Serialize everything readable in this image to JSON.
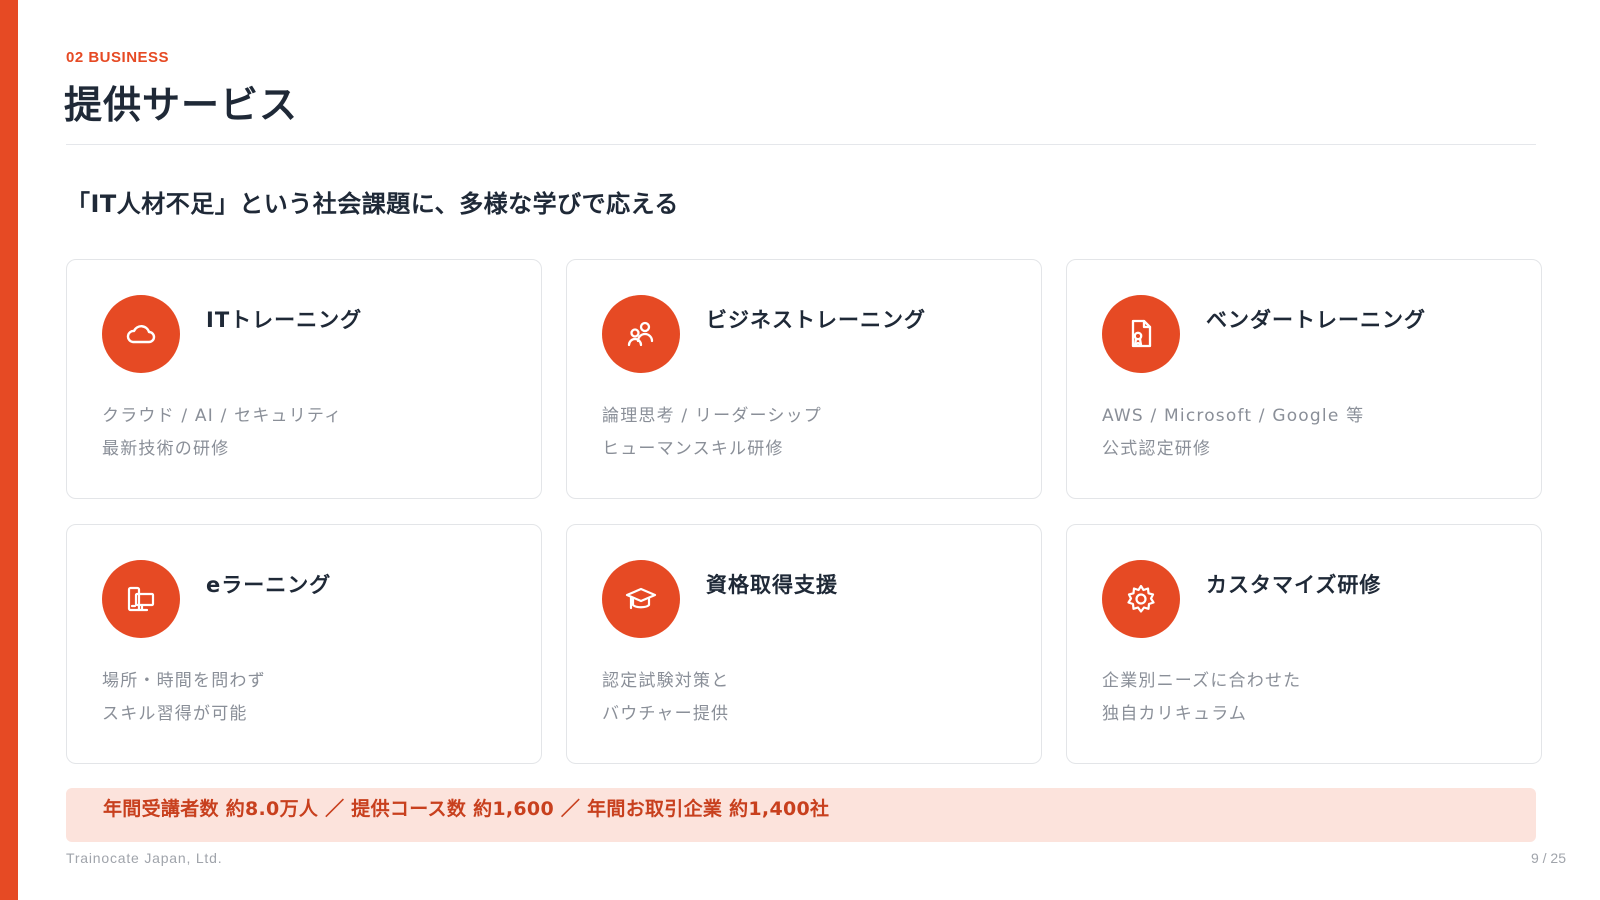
{
  "header": {
    "section_label": "02  BUSINESS",
    "title": "提供サービス"
  },
  "headline": "「IT人材不足」という社会課題に、多様な学びで応える",
  "colors": {
    "accent": "#e64a24",
    "stats_bg": "#fce3dc",
    "stats_text": "#c8401e"
  },
  "services": [
    {
      "icon": "cloud-icon",
      "title": "ITトレーニング",
      "desc_line1": "クラウド / AI / セキュリティ",
      "desc_line2": "最新技術の研修"
    },
    {
      "icon": "people-icon",
      "title": "ビジネストレーニング",
      "desc_line1": "論理思考 / リーダーシップ",
      "desc_line2": "ヒューマンスキル研修"
    },
    {
      "icon": "certificate-document-icon",
      "title": "ベンダートレーニング",
      "desc_line1": "AWS / Microsoft / Google 等",
      "desc_line2": "公式認定研修"
    },
    {
      "icon": "devices-icon",
      "title": "eラーニング",
      "desc_line1": "場所・時間を問わず",
      "desc_line2": "スキル習得が可能"
    },
    {
      "icon": "graduation-cap-icon",
      "title": "資格取得支援",
      "desc_line1": "認定試験対策と",
      "desc_line2": "バウチャー提供"
    },
    {
      "icon": "gear-icon",
      "title": "カスタマイズ研修",
      "desc_line1": "企業別ニーズに合わせた",
      "desc_line2": "独自カリキュラム"
    }
  ],
  "stats": "年間受講者数 約8.0万人 ／ 提供コース数 約1,600 ／ 年間お取引企業 約1,400社",
  "footer": {
    "company": "Trainocate Japan, Ltd.",
    "page": "9 / 25"
  }
}
